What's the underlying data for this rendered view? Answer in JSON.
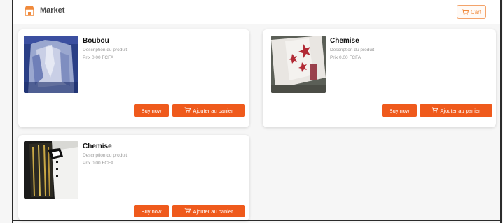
{
  "header": {
    "brand": "Market",
    "cart_label": "Cart"
  },
  "colors": {
    "accent": "#ef5a1c",
    "card_bg": "#ffffff",
    "page_bg": "#f6f6f6"
  },
  "products": [
    {
      "name": "Boubou",
      "description": "Description du produit",
      "price": "Prix 0.00 FCFA",
      "buy_label": "Buy now",
      "add_label": "Ajouter au panier"
    },
    {
      "name": "Chemise",
      "description": "Description du produit",
      "price": "Prix 0.00 FCFA",
      "buy_label": "Buy now",
      "add_label": "Ajouter au panier"
    },
    {
      "name": "Chemise",
      "description": "Description du produit",
      "price": "Prix 0.00 FCFA",
      "buy_label": "Buy now",
      "add_label": "Ajouter au panier"
    }
  ]
}
